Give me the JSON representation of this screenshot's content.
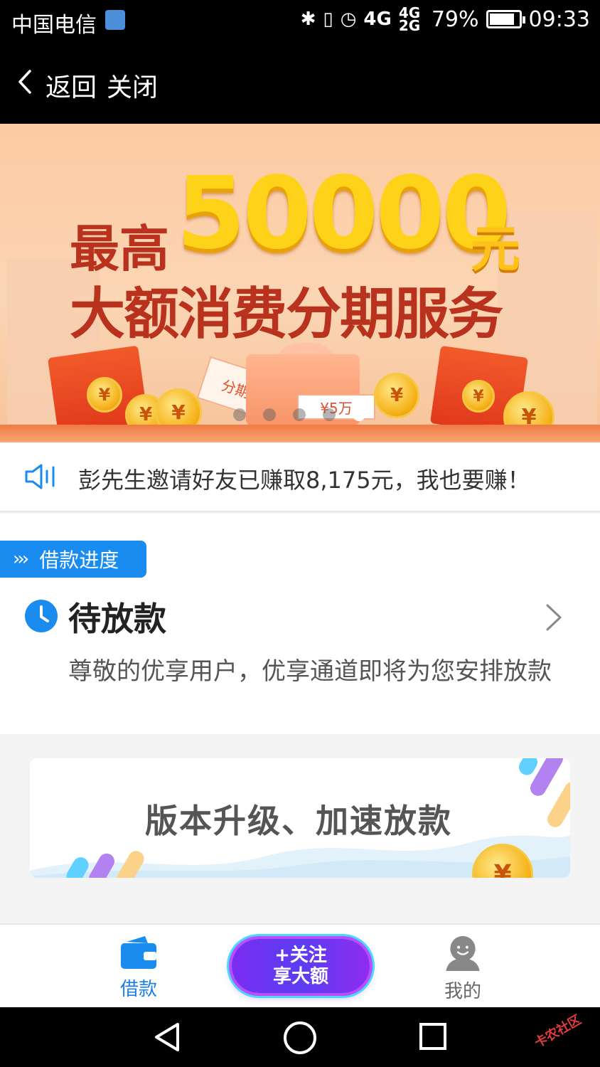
{
  "status_bar": {
    "carrier": "中国电信",
    "network": "4G",
    "network_small": "4G 2G",
    "battery": "79%",
    "time": "09:33"
  },
  "nav": {
    "back_label": "返回",
    "close_label": "关闭"
  },
  "banner": {
    "line1": "最高",
    "amount": "50000",
    "unit": "元",
    "line2": "大额消费分期服务",
    "ticket_label": "分期",
    "voucher_label": "¥5万",
    "coin_symbol": "¥",
    "dots_total": 5,
    "active_dot_index": 4
  },
  "notice": {
    "text": "彭先生邀请好友已赚取8,175元，我也要赚！"
  },
  "loan": {
    "tag_arrows": "›››",
    "tag_label": "借款进度",
    "status": "待放款",
    "description": "尊敬的优享用户，优享通道即将为您安排放款"
  },
  "promo": {
    "title": "版本升级、加速放款",
    "coin_symbol": "¥"
  },
  "tabbar": {
    "borrow_label": "借款",
    "follow_line1": "+关注",
    "follow_line2": "享大额",
    "mine_label": "我的"
  },
  "watermark": "卡农社区",
  "colors": {
    "accent": "#1a8cf0",
    "banner_text": "#b8321e",
    "amount_gold": "#ffd21a"
  }
}
